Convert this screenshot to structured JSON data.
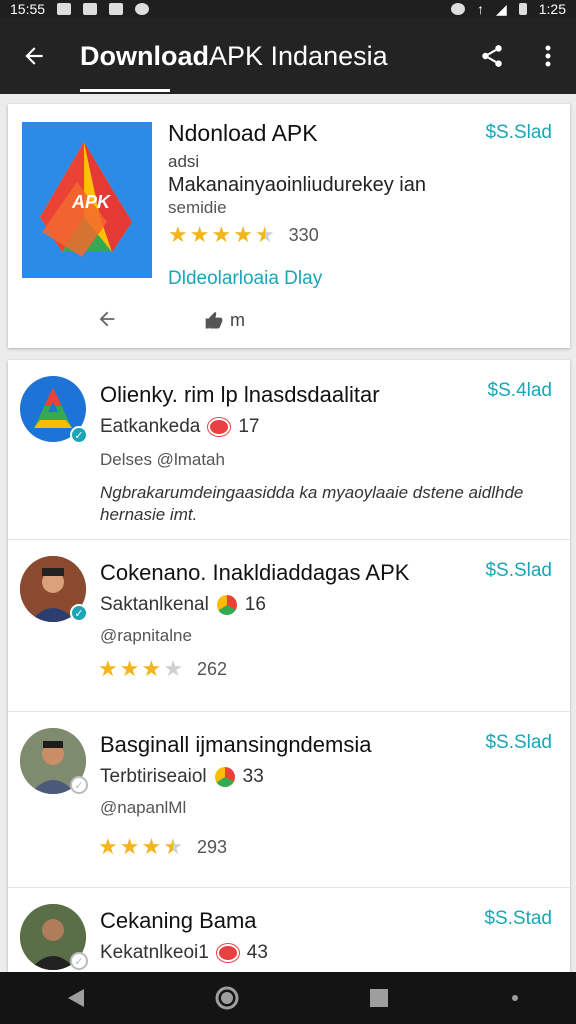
{
  "status_bar": {
    "time_left": "15:55",
    "time_right": "1:25"
  },
  "app_bar": {
    "title_bold": "Download",
    "title_rest": " APK Indanesia"
  },
  "featured": {
    "title": "Ndonload APK",
    "price": "$S.Slad",
    "sub1": "adsi",
    "sub2": "Makanainyaoinliudurekey ian",
    "sub3": "semidie",
    "rating_count": "330",
    "rating": 4.5,
    "link": "Dldeolarloaia Dlay",
    "like_label": "m",
    "logo_text": "APK"
  },
  "items": [
    {
      "title": "Olienky. rim lp lnasdsdaalitar",
      "price": "$S.4lad",
      "meta": "Eatkankeda",
      "meta_count": "17",
      "handle": "Delses @lmatah",
      "desc": "Ngbrakarumdeingaasidda ka myaoylaaie dstene aidlhde hernasie imt."
    },
    {
      "title": "Cokenano. Inakldiaddagas APK",
      "price": "$S.Slad",
      "meta": "Saktanlkenal",
      "meta_count": "16",
      "handle": "@rapnitalne",
      "rating_count": "262",
      "rating": 3
    },
    {
      "title": "Basginall ijmansingndemsia",
      "price": "$S.Slad",
      "meta": "Terbtiriseaiol",
      "meta_count": "33",
      "handle": "@napanlMl",
      "rating_count": "293",
      "rating": 3.5
    },
    {
      "title": "Cekaning Bama",
      "price": "$S.Stad",
      "meta": "Kekatnlkeoi1",
      "meta_count": "43"
    }
  ],
  "colors": {
    "accent": "#1aa6b7",
    "star": "#f3b51c",
    "appbar": "#232323"
  }
}
